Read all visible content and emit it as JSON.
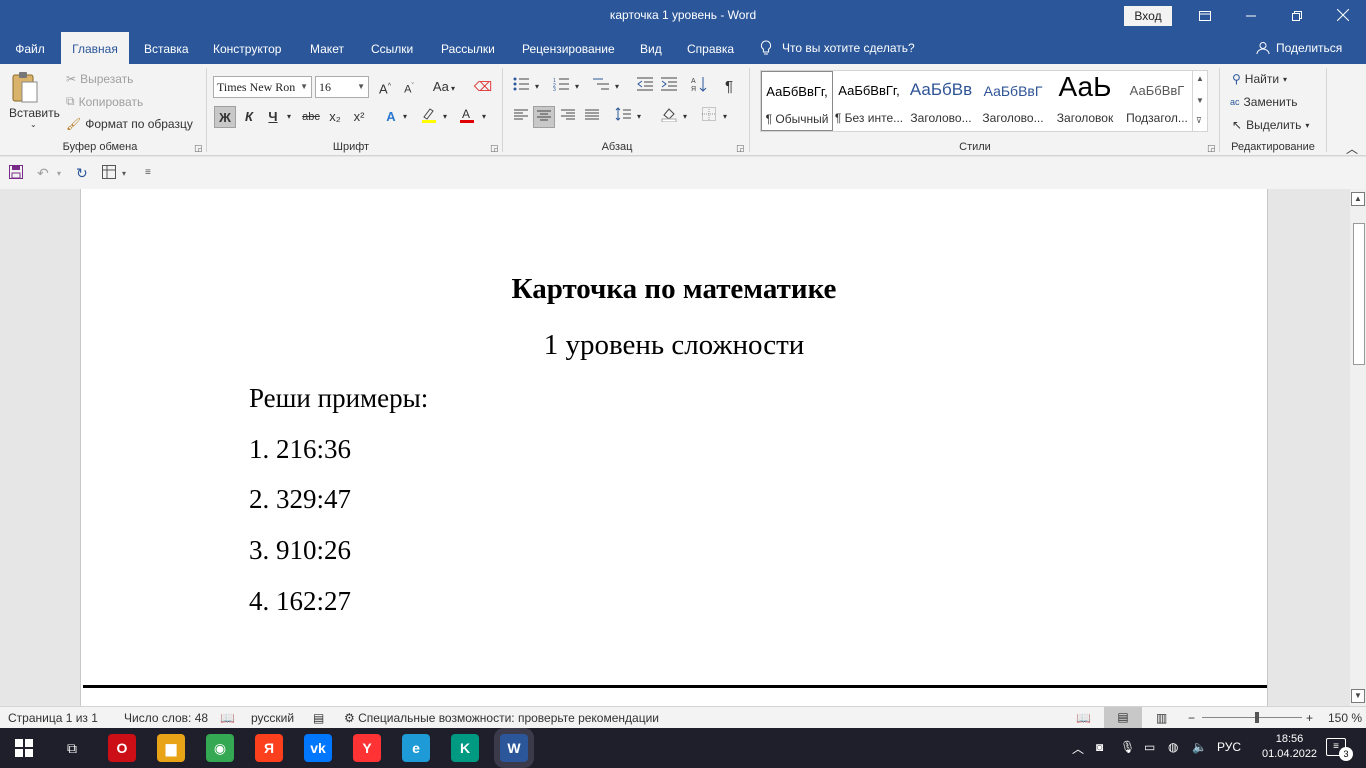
{
  "window": {
    "title": "карточка 1 уровень  -  Word",
    "signin_label": "Вход",
    "icons": [
      "restore-ribbon-icon",
      "minimize-icon",
      "maximize-icon",
      "close-icon"
    ]
  },
  "menu": {
    "tabs": [
      "Файл",
      "Главная",
      "Вставка",
      "Конструктор",
      "Макет",
      "Ссылки",
      "Рассылки",
      "Рецензирование",
      "Вид",
      "Справка"
    ],
    "active_tab": "Главная",
    "tell_me": "Что вы хотите сделать?",
    "share": "Поделиться"
  },
  "ribbon": {
    "clipboard": {
      "paste": "Вставить",
      "cut": "Вырезать",
      "copy": "Копировать",
      "format_painter": "Формат по образцу",
      "label": "Буфер обмена"
    },
    "font": {
      "font_name": "Times New Ron",
      "font_size": "16",
      "bold": "Ж",
      "italic": "К",
      "underline": "Ч",
      "strike": "abc",
      "subscript": "x₂",
      "superscript": "x²",
      "case": "Aa",
      "grow": "A",
      "shrink": "A",
      "label": "Шрифт"
    },
    "paragraph": {
      "pilcrow": "¶",
      "label": "Абзац"
    },
    "styles": {
      "items": [
        {
          "preview": "АаБбВвГг,",
          "name": "¶ Обычный"
        },
        {
          "preview": "АаБбВвГг,",
          "name": "¶ Без инте..."
        },
        {
          "preview": "АаБбВв",
          "name": "Заголово..."
        },
        {
          "preview": "АаБбВвГ",
          "name": "Заголово..."
        },
        {
          "preview": "АаЬ",
          "name": "Заголовок"
        },
        {
          "preview": "АаБбВвГ",
          "name": "Подзагол..."
        }
      ],
      "label": "Стили"
    },
    "editing": {
      "find": "Найти",
      "replace": "Заменить",
      "select": "Выделить",
      "label": "Редактирование"
    }
  },
  "document": {
    "heading": "Карточка по математике",
    "subheading": "1 уровень сложности",
    "instruction": "Реши примеры:",
    "items": [
      "1. 216:36",
      "2. 329:47",
      "3. 910:26",
      "4. 162:27"
    ]
  },
  "status": {
    "page": "Страница 1 из 1",
    "words": "Число слов: 48",
    "language": "русский",
    "accessibility": "Специальные возможности: проверьте рекомендации",
    "zoom": "150 %",
    "zoom_minus": "−",
    "zoom_plus": "+"
  },
  "taskbar": {
    "apps": [
      {
        "name": "opera",
        "glyph": "O",
        "color": "#cc0f16"
      },
      {
        "name": "explorer",
        "glyph": "▆",
        "color": "#e8a317"
      },
      {
        "name": "chrome",
        "glyph": "◉",
        "color": "#34a853"
      },
      {
        "name": "yandex",
        "glyph": "Я",
        "color": "#fc3f1d"
      },
      {
        "name": "vk",
        "glyph": "vk",
        "color": "#0077ff"
      },
      {
        "name": "yandex-browser",
        "glyph": "Y",
        "color": "#ff3333"
      },
      {
        "name": "edge",
        "glyph": "e",
        "color": "#1e9ad6"
      },
      {
        "name": "kaspersky",
        "glyph": "K",
        "color": "#009982"
      },
      {
        "name": "word",
        "glyph": "W",
        "color": "#2b579a"
      }
    ],
    "lang": "РУС",
    "time": "18:56",
    "date": "01.04.2022",
    "notifications": "3"
  }
}
